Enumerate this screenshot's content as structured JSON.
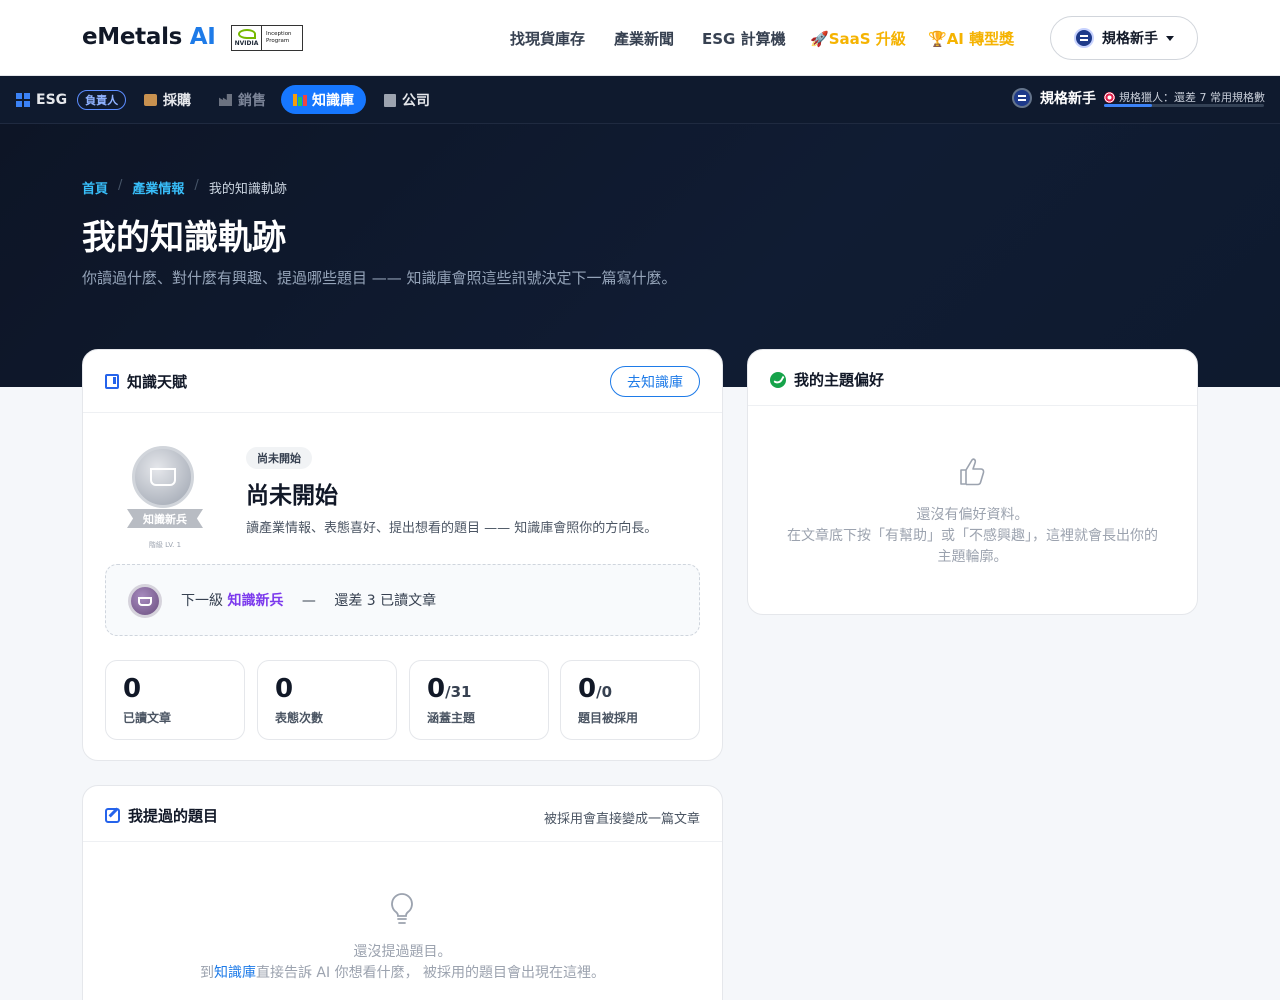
{
  "brand": {
    "name": "eMetals",
    "ai": "AI",
    "partner_top": "Inception",
    "partner_bottom": "Program",
    "partner_logo": "NVIDIA"
  },
  "topnav": [
    {
      "label": "找現貨庫存"
    },
    {
      "label": "產業新聞"
    },
    {
      "label": "ESG 計算機"
    },
    {
      "label": "SaaS 升級",
      "icon": "rocket-icon"
    },
    {
      "label": "AI 轉型獎",
      "icon": "trophy-icon"
    }
  ],
  "user": {
    "name": "規格新手"
  },
  "subnav": {
    "esg": "ESG",
    "role_tag": "負責人",
    "purchase": "採購",
    "sales": "銷售",
    "knowledge": "知識庫",
    "company": "公司",
    "user_name": "規格新手",
    "hunter_text": "規格獵人：還差 7 常用規格數",
    "progress": 0.3
  },
  "breadcrumb": {
    "home": "首頁",
    "section": "產業情報",
    "current": "我的知識軌跡"
  },
  "hero": {
    "title": "我的知識軌跡",
    "subtitle": "你讀過什麼、對什麼有興趣、提過哪些題目 —— 知識庫會照這些訊號決定下一篇寫什麼。"
  },
  "talent": {
    "title": "知識天賦",
    "goto_button": "去知識庫",
    "badge_name": "知識新兵",
    "badge_level": "階級 LV. 1",
    "state_tag": "尚未開始",
    "state_title": "尚未開始",
    "state_desc": "讀產業情報、表態喜好、提出想看的題目 —— 知識庫會照你的方向長。",
    "next_prefix": "下一級",
    "next_level": "知識新兵",
    "next_dash": "—",
    "next_remaining": "還差 3 已讀文章",
    "stats": [
      {
        "value": "0",
        "suffix": "",
        "label": "已讀文章"
      },
      {
        "value": "0",
        "suffix": "",
        "label": "表態次數"
      },
      {
        "value": "0",
        "suffix": "/31",
        "label": "涵蓋主題"
      },
      {
        "value": "0",
        "suffix": "/0",
        "label": "題目被採用"
      }
    ]
  },
  "preferences": {
    "title": "我的主題偏好",
    "empty_line1": "還沒有偏好資料。",
    "empty_line2": "在文章底下按「有幫助」或「不感興趣」，這裡就會長出你的",
    "empty_line3": "主題輪廓。"
  },
  "topics": {
    "title": "我提過的題目",
    "note": "被採用會直接變成一篇文章",
    "empty_line1": "還沒提過題目。",
    "empty_pre": "到",
    "empty_link": "知識庫",
    "empty_post": "直接告訴 AI 你想看什麼， 被採用的題目會出現在這裡。"
  },
  "colors": {
    "accent": "#1e7be8",
    "gold": "#f5b301",
    "hero_bg": "#0d1526",
    "purple": "#7c3aed"
  }
}
